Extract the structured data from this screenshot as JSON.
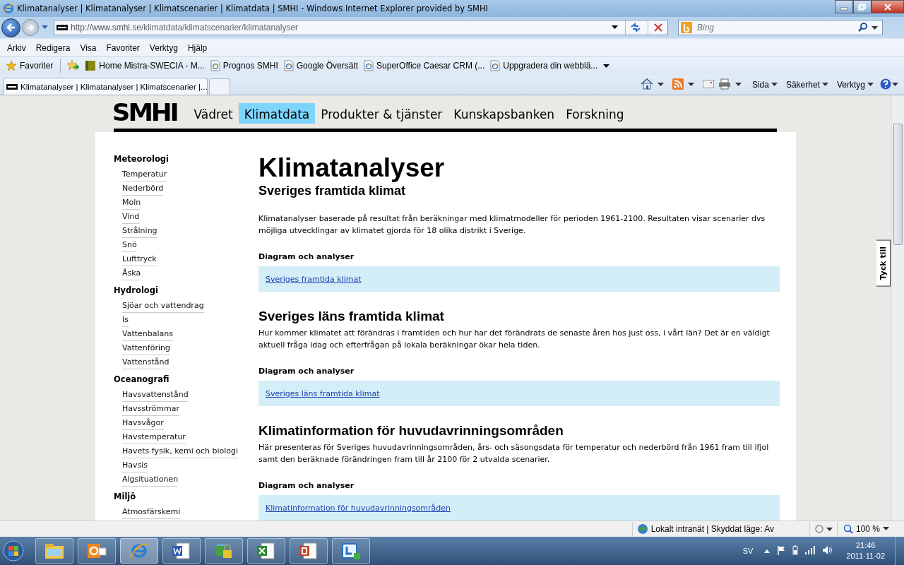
{
  "window": {
    "title": "Klimatanalyser | Klimatanalyser | Klimatscenarier | Klimatdata | SMHI - Windows Internet Explorer provided by SMHI"
  },
  "nav": {
    "address_host": "http://www.smhi.se",
    "address_path": "/klimatdata/klimatscenarier/klimatanalyser",
    "search_placeholder": "Bing"
  },
  "menu": [
    "Arkiv",
    "Redigera",
    "Visa",
    "Favoriter",
    "Verktyg",
    "Hjälp"
  ],
  "favorites": {
    "label": "Favoriter",
    "items": [
      {
        "label": "Home Mistra-SWECIA - M...",
        "kind": "site"
      },
      {
        "label": "Prognos  SMHI",
        "kind": "ie"
      },
      {
        "label": "Google Översätt",
        "kind": "ie"
      },
      {
        "label": "SuperOffice Caesar CRM (...",
        "kind": "ie"
      },
      {
        "label": "Uppgradera din webblä...",
        "kind": "ie"
      }
    ]
  },
  "tab": {
    "title": "Klimatanalyser | Klimatanalyser | Klimatscenarier |..."
  },
  "command_bar": [
    "Sida",
    "Säkerhet",
    "Verktyg"
  ],
  "site": {
    "logo": "SMHI",
    "nav": [
      {
        "label": "Vädret",
        "selected": false
      },
      {
        "label": "Klimatdata",
        "selected": true
      },
      {
        "label": "Produkter & tjänster",
        "selected": false
      },
      {
        "label": "Kunskapsbanken",
        "selected": false
      },
      {
        "label": "Forskning",
        "selected": false
      }
    ],
    "sidebar": [
      {
        "heading": "Meteorologi",
        "items": [
          "Temperatur",
          "Nederbörd",
          "Moln",
          "Vind",
          "Strålning",
          "Snö",
          "Lufttryck",
          "Åska"
        ]
      },
      {
        "heading": "Hydrologi",
        "items": [
          "Sjöar och vattendrag",
          "Is",
          "Vattenbalans",
          "Vattenföring",
          "Vattenstånd"
        ]
      },
      {
        "heading": "Oceanografi",
        "items": [
          "Havsvattenstånd",
          "Havsströmmar",
          "Havsvågor",
          "Havstemperatur",
          "Havets fysik, kemi och biologi",
          "Havsis",
          "Algsituationen"
        ]
      },
      {
        "heading": "Miljö",
        "items": [
          "Atmosfärskemi"
        ]
      }
    ],
    "heading": "Klimatanalyser",
    "sections": [
      {
        "title": "Sveriges framtida klimat",
        "text": "Klimatanalyser baserade på resultat från beräkningar med klimatmodeller för perioden 1961-2100. Resultaten visar scenarier dvs möjliga utvecklingar av klimatet gjorda för 18 olika distrikt i Sverige.",
        "label": "Diagram och analyser",
        "link": "Sveriges framtida klimat"
      },
      {
        "title": "Sveriges läns framtida klimat",
        "text": "Hur kommer klimatet att förändras i framtiden och hur har det förändrats de senaste åren hos just oss, i vårt län? Det är en väldigt aktuell fråga idag och efterfrågan på lokala beräkningar ökar hela tiden.",
        "label": "Diagram och analyser",
        "link": "Sveriges läns framtida klimat"
      },
      {
        "title": "Klimatinformation för huvudavrinningsområden",
        "text": "Här presenteras för Sveriges huvudavrinningsområden, års- och säsongsdata för temperatur och nederbörd från 1961 fram till ifjol samt den beräknade förändringen fram till år 2100 för 2 utvalda scenarier.",
        "label": "Diagram och analyser",
        "link": "Klimatinformation för huvudavrinningsområden"
      }
    ],
    "feedback_tab": "Tyck till"
  },
  "status": {
    "zone": "Lokalt intranät | Skyddat läge: Av",
    "zoom": "100 %"
  },
  "taskbar": {
    "language": "SV",
    "time": "21:46",
    "date": "2011-11-02"
  }
}
